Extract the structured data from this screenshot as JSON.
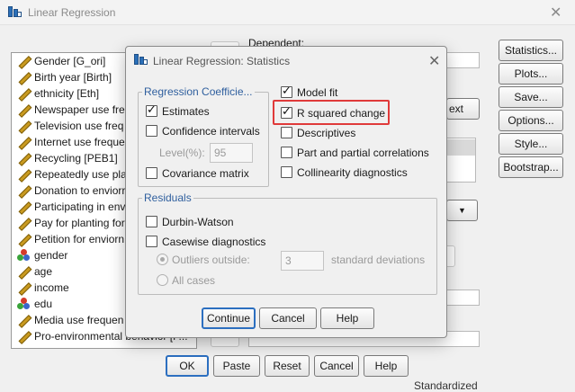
{
  "outer_window": {
    "title": "Linear Regression",
    "close_glyph": "✕",
    "variables": [
      {
        "label": "Gender [G_ori]",
        "icon": "scale-icon"
      },
      {
        "label": "Birth year [Birth]",
        "icon": "scale-icon"
      },
      {
        "label": "ethnicity [Eth]",
        "icon": "scale-icon"
      },
      {
        "label": "Newspaper use freq",
        "icon": "scale-icon"
      },
      {
        "label": "Television use freq",
        "icon": "scale-icon"
      },
      {
        "label": "Internet use freque",
        "icon": "scale-icon"
      },
      {
        "label": "Recycling [PEB1]",
        "icon": "scale-icon"
      },
      {
        "label": "Repeatedly use pla",
        "icon": "scale-icon"
      },
      {
        "label": "Donation to enviorr",
        "icon": "scale-icon"
      },
      {
        "label": "Participating in env",
        "icon": "scale-icon"
      },
      {
        "label": "Pay for planting for",
        "icon": "scale-icon"
      },
      {
        "label": "Petition for enviorn",
        "icon": "scale-icon"
      },
      {
        "label": "gender",
        "icon": "nominal-icon"
      },
      {
        "label": "age",
        "icon": "scale-icon"
      },
      {
        "label": "income",
        "icon": "scale-icon"
      },
      {
        "label": "edu",
        "icon": "nominal-icon"
      },
      {
        "label": "Media use frequen",
        "icon": "scale-icon"
      },
      {
        "label": "Pro-environmental behavior [P...",
        "icon": "scale-icon"
      }
    ],
    "dependent_label": "Dependent:",
    "next_label": "ext",
    "standardized_label": "Standardized",
    "side_buttons": [
      "Statistics...",
      "Plots...",
      "Save...",
      "Options...",
      "Style...",
      "Bootstrap..."
    ],
    "bottom_buttons": [
      "OK",
      "Paste",
      "Reset",
      "Cancel",
      "Help"
    ]
  },
  "dialog": {
    "title": "Linear Regression: Statistics",
    "close_glyph": "✕",
    "coefficients_group": {
      "legend": "Regression Coefficie...",
      "estimates_label": "Estimates",
      "estimates_checked": true,
      "confidence_label": "Confidence intervals",
      "confidence_checked": false,
      "level_label": "Level(%):",
      "level_value": "95",
      "covariance_label": "Covariance matrix",
      "covariance_checked": false
    },
    "right_options": [
      {
        "label": "Model fit",
        "checked": true
      },
      {
        "label": "R squared change",
        "checked": true
      },
      {
        "label": "Descriptives",
        "checked": false
      },
      {
        "label": "Part and partial correlations",
        "checked": false
      },
      {
        "label": "Collinearity diagnostics",
        "checked": false
      }
    ],
    "residuals_group": {
      "legend": "Residuals",
      "durbin_label": "Durbin-Watson",
      "durbin_checked": false,
      "casewise_label": "Casewise diagnostics",
      "casewise_checked": false,
      "outliers_label": "Outliers outside:",
      "outliers_value": "3",
      "std_dev_label": "standard deviations",
      "all_cases_label": "All cases"
    },
    "buttons": {
      "continue": "Continue",
      "cancel": "Cancel",
      "help": "Help"
    },
    "highlight_color": "#e03a3a"
  }
}
